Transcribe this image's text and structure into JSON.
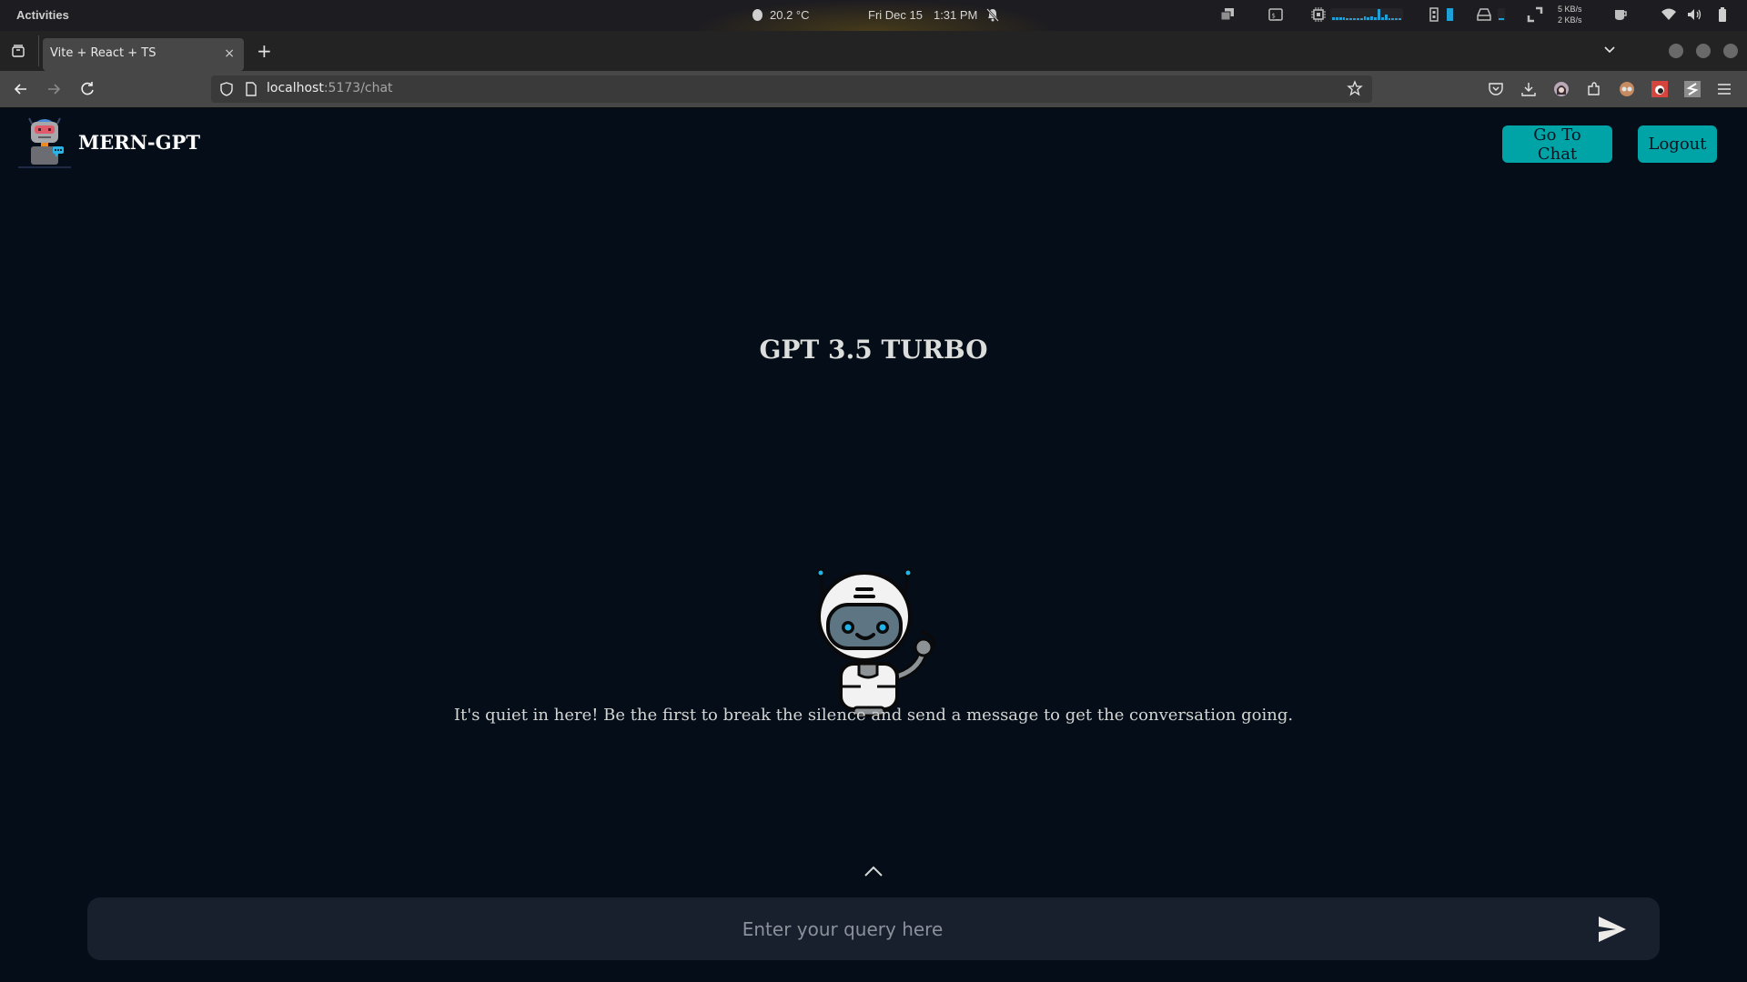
{
  "system_bar": {
    "activities": "Activities",
    "weather": "20.2 °C",
    "date": "Fri Dec 15",
    "time": "1:31 PM",
    "net_down": "5 KB/s",
    "net_up": "2 KB/s",
    "cpu_graph_levels": [
      0.25,
      0.25,
      0.25,
      0.25,
      0.2,
      0.2,
      0.2,
      0.2,
      0.2,
      0.3,
      0.25,
      0.35,
      0.25,
      1.0,
      0.25,
      0.5,
      0.2,
      0.2,
      0.2,
      0.2
    ],
    "accent": "#1fa1d8"
  },
  "browser": {
    "tab": {
      "title": "Vite + React + TS",
      "close": "×"
    },
    "new_tab": "+",
    "url_host": "localhost",
    "url_rest": ":5173/chat"
  },
  "app": {
    "brand": "MERN-GPT",
    "nav": {
      "go_to_chat": "Go To Chat",
      "logout": "Logout"
    },
    "accent": "#00a4a6",
    "model_title": "GPT 3.5 TURBO",
    "empty_message": "It's quiet in here! Be the first to break the silence and send a message to get the conversation going.",
    "input": {
      "placeholder": "Enter your query here",
      "value": ""
    }
  }
}
